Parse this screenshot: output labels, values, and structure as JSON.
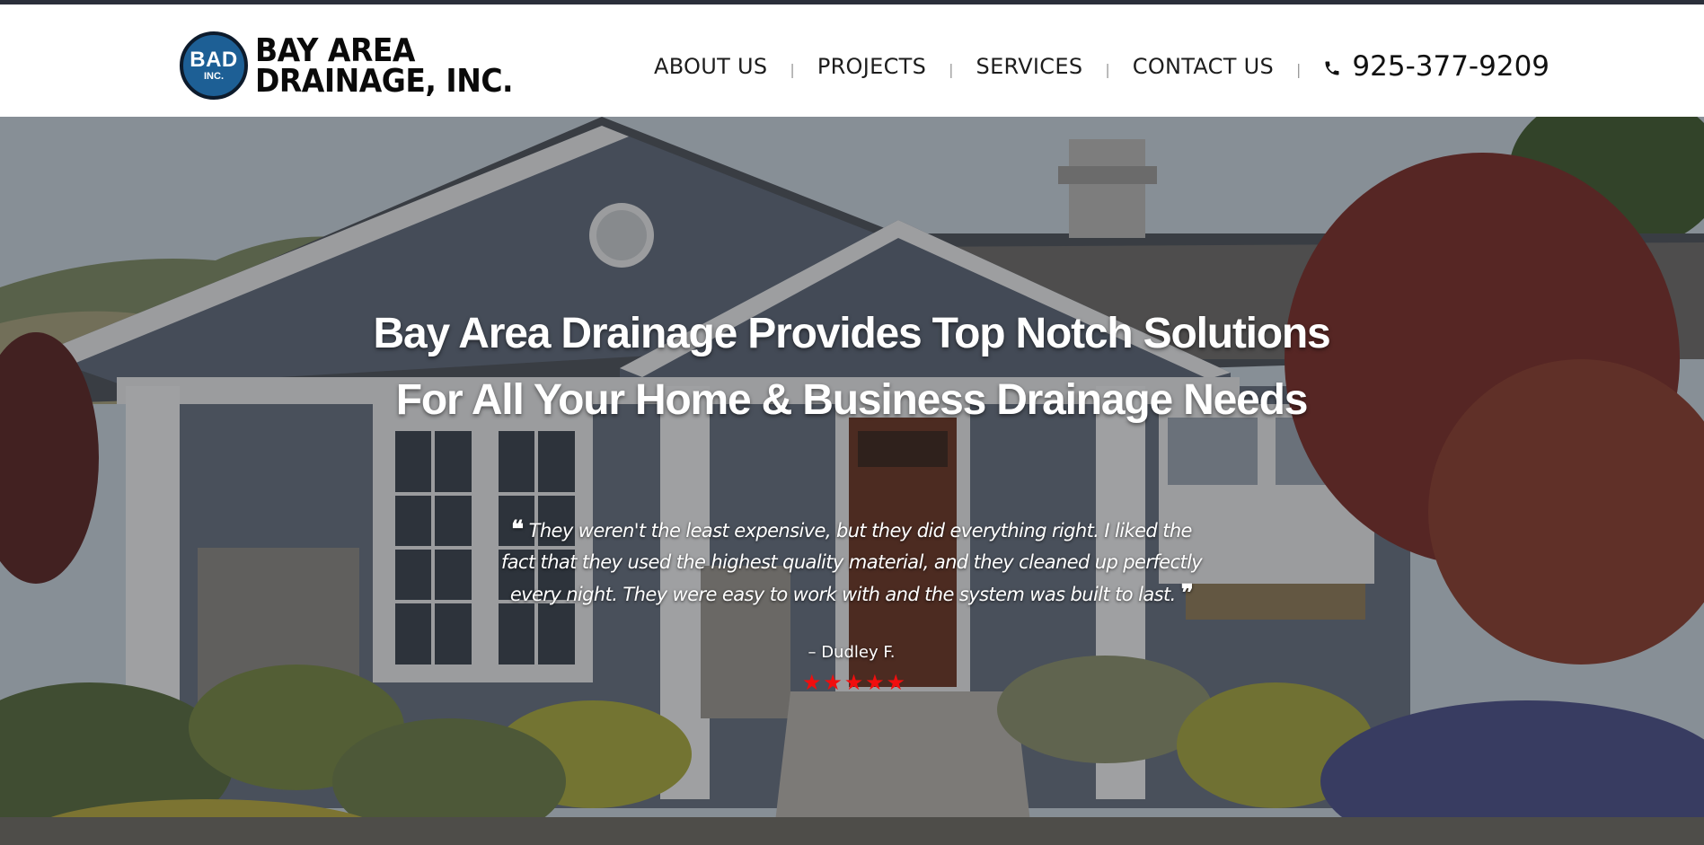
{
  "brand": {
    "badge_main": "BAD",
    "badge_sub": "INC.",
    "name_line1": "BAY AREA",
    "name_line2": "DRAINAGE, INC."
  },
  "nav": {
    "items": [
      {
        "label": "ABOUT US"
      },
      {
        "label": "PROJECTS"
      },
      {
        "label": "SERVICES"
      },
      {
        "label": "CONTACT US"
      }
    ],
    "separator": "|",
    "phone": "925-377-9209",
    "phone_icon": "phone-icon"
  },
  "hero": {
    "title_line1": "Bay Area Drainage Provides Top Notch Solutions",
    "title_line2": "For All Your Home & Business Drainage Needs",
    "quote_open": "❝",
    "quote_close": "❞",
    "testimonial": "They weren't the least expensive, but they did everything right. I liked the fact that they used the highest quality material, and they cleaned up perfectly every night. They were easy to work with and the system was built to last.",
    "author": "– Dudley F.",
    "rating": 5,
    "star_glyph": "★"
  },
  "colors": {
    "top_bar": "#2b2f3a",
    "badge_blue": "#1d5f95",
    "star_red": "#f10e0e"
  }
}
